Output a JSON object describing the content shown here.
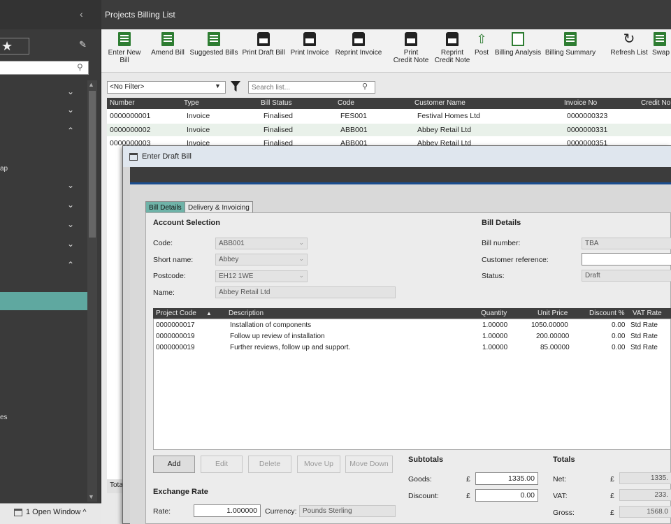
{
  "nav": {
    "items": [
      "ap",
      "es"
    ],
    "open_windows": "1 Open Window ^"
  },
  "main": {
    "title": "Projects Billing List",
    "toolbar": [
      {
        "label": "Enter New Bill",
        "icon": "new-bill-icon"
      },
      {
        "label": "Amend Bill",
        "icon": "amend-bill-icon"
      },
      {
        "label": "Suggested Bills",
        "icon": "suggested-bills-icon"
      },
      {
        "label": "Print Draft Bill",
        "icon": "printer-icon"
      },
      {
        "label": "Print Invoice",
        "icon": "printer-icon"
      },
      {
        "label": "Reprint Invoice",
        "icon": "printer-icon"
      },
      {
        "label": "Print\nCredit Note",
        "icon": "printer-icon"
      },
      {
        "label": "Reprint\nCredit Note",
        "icon": "printer-icon"
      },
      {
        "label": "Post",
        "icon": "post-icon"
      },
      {
        "label": "Billing Analysis",
        "icon": "chart-icon"
      },
      {
        "label": "Billing Summary",
        "icon": "summary-icon"
      },
      {
        "label": "Refresh List",
        "icon": "refresh-icon"
      },
      {
        "label": "Swap",
        "icon": "swap-icon"
      }
    ],
    "filter": {
      "value": "<No Filter>",
      "search_placeholder": "Search list..."
    },
    "columns": [
      "Number",
      "Type",
      "Bill Status",
      "Code",
      "Customer Name",
      "Invoice No",
      "Credit No"
    ],
    "rows": [
      [
        "0000000001",
        "Invoice",
        "Finalised",
        "FES001",
        "Festival Homes Ltd",
        "0000000323"
      ],
      [
        "0000000002",
        "Invoice",
        "Finalised",
        "ABB001",
        "Abbey Retail Ltd",
        "0000000331"
      ],
      [
        "0000000003",
        "Invoice",
        "Finalised",
        "ABB001",
        "Abbey Retail Ltd",
        "0000000351"
      ]
    ],
    "total_label": "Tota"
  },
  "dialog": {
    "title": "Enter Draft Bill",
    "tabs": [
      "Bill Details",
      "Delivery & Invoicing"
    ],
    "account": {
      "section": "Account Selection",
      "code_label": "Code:",
      "code": "ABB001",
      "short_label": "Short name:",
      "short": "Abbey",
      "postcode_label": "Postcode:",
      "postcode": "EH12 1WE",
      "name_label": "Name:",
      "name": "Abbey Retail Ltd"
    },
    "bill": {
      "section": "Bill Details",
      "number_label": "Bill number:",
      "number": "TBA",
      "ref_label": "Customer reference:",
      "ref": "",
      "status_label": "Status:",
      "status": "Draft"
    },
    "grid": {
      "columns": [
        "Project Code",
        "Description",
        "Quantity",
        "Unit Price",
        "Discount %",
        "VAT Rate"
      ],
      "rows": [
        [
          "0000000017",
          "Installation of components",
          "1.00000",
          "1050.00000",
          "0.00",
          "Std Rate"
        ],
        [
          "0000000019",
          "Follow up review of installation",
          "1.00000",
          "200.00000",
          "0.00",
          "Std Rate"
        ],
        [
          "0000000019",
          "Further reviews, follow up and support.",
          "1.00000",
          "85.00000",
          "0.00",
          "Std Rate"
        ]
      ]
    },
    "buttons": {
      "add": "Add",
      "edit": "Edit",
      "delete": "Delete",
      "move_up": "Move Up",
      "move_down": "Move Down"
    },
    "exchange": {
      "section": "Exchange Rate",
      "rate_label": "Rate:",
      "rate": "1.000000",
      "currency_label": "Currency:",
      "currency": "Pounds Sterling"
    },
    "subtotals": {
      "section": "Subtotals",
      "goods_label": "Goods:",
      "goods": "1335.00",
      "discount_label": "Discount:",
      "discount": "0.00",
      "currency_symbol": "£"
    },
    "totals": {
      "section": "Totals",
      "net_label": "Net:",
      "net": "1335.",
      "vat_label": "VAT:",
      "vat": "233.",
      "gross_label": "Gross:",
      "gross": "1568.0"
    }
  }
}
